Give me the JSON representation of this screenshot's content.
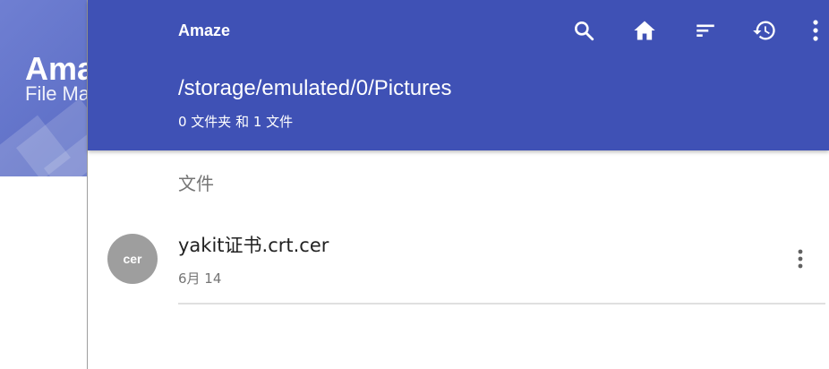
{
  "drawer": {
    "title": "Amaze",
    "subtitle": "File Manager"
  },
  "appbar": {
    "title": "Amaze",
    "path": "/storage/emulated/0/Pictures",
    "summary": "0 文件夹 和 1 文件",
    "icons": [
      "search-icon",
      "home-icon",
      "sort-icon",
      "history-icon",
      "more-vert-icon"
    ],
    "color": "#3f51b5"
  },
  "section": {
    "files_header": "文件"
  },
  "files": [
    {
      "icon_text": "cer",
      "name": "yakit证书.crt.cer",
      "date": "6月 14"
    }
  ]
}
